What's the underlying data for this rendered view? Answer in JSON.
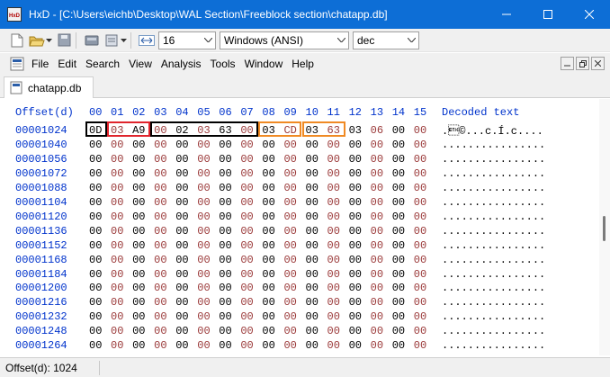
{
  "window": {
    "title": "HxD - [C:\\Users\\eichb\\Desktop\\WAL Section\\Freeblock section\\chatapp.db]",
    "app_icon_text": "HxD"
  },
  "toolbar": {
    "bytes_per_row": "16",
    "charset": "Windows (ANSI)",
    "offset_base": "dec"
  },
  "menu": [
    "File",
    "Edit",
    "Search",
    "View",
    "Analysis",
    "Tools",
    "Window",
    "Help"
  ],
  "tab": {
    "label": "chatapp.db"
  },
  "hex": {
    "offset_header": "Offset(d)",
    "columns": [
      "00",
      "01",
      "02",
      "03",
      "04",
      "05",
      "06",
      "07",
      "08",
      "09",
      "10",
      "11",
      "12",
      "13",
      "14",
      "15"
    ],
    "decoded_header": "Decoded text",
    "rows": [
      {
        "offset": "00001024",
        "bytes": [
          "0D",
          "03",
          "A9",
          "00",
          "02",
          "03",
          "63",
          "00",
          "03",
          "CD",
          "03",
          "63",
          "03",
          "06",
          "00",
          "00"
        ],
        "decoded": ".\u0003©...c.Í.c...."
      },
      {
        "offset": "00001040",
        "bytes": [
          "00",
          "00",
          "00",
          "00",
          "00",
          "00",
          "00",
          "00",
          "00",
          "00",
          "00",
          "00",
          "00",
          "00",
          "00",
          "00"
        ],
        "decoded": "................"
      },
      {
        "offset": "00001056",
        "bytes": [
          "00",
          "00",
          "00",
          "00",
          "00",
          "00",
          "00",
          "00",
          "00",
          "00",
          "00",
          "00",
          "00",
          "00",
          "00",
          "00"
        ],
        "decoded": "................"
      },
      {
        "offset": "00001072",
        "bytes": [
          "00",
          "00",
          "00",
          "00",
          "00",
          "00",
          "00",
          "00",
          "00",
          "00",
          "00",
          "00",
          "00",
          "00",
          "00",
          "00"
        ],
        "decoded": "................"
      },
      {
        "offset": "00001088",
        "bytes": [
          "00",
          "00",
          "00",
          "00",
          "00",
          "00",
          "00",
          "00",
          "00",
          "00",
          "00",
          "00",
          "00",
          "00",
          "00",
          "00"
        ],
        "decoded": "................"
      },
      {
        "offset": "00001104",
        "bytes": [
          "00",
          "00",
          "00",
          "00",
          "00",
          "00",
          "00",
          "00",
          "00",
          "00",
          "00",
          "00",
          "00",
          "00",
          "00",
          "00"
        ],
        "decoded": "................"
      },
      {
        "offset": "00001120",
        "bytes": [
          "00",
          "00",
          "00",
          "00",
          "00",
          "00",
          "00",
          "00",
          "00",
          "00",
          "00",
          "00",
          "00",
          "00",
          "00",
          "00"
        ],
        "decoded": "................"
      },
      {
        "offset": "00001136",
        "bytes": [
          "00",
          "00",
          "00",
          "00",
          "00",
          "00",
          "00",
          "00",
          "00",
          "00",
          "00",
          "00",
          "00",
          "00",
          "00",
          "00"
        ],
        "decoded": "................"
      },
      {
        "offset": "00001152",
        "bytes": [
          "00",
          "00",
          "00",
          "00",
          "00",
          "00",
          "00",
          "00",
          "00",
          "00",
          "00",
          "00",
          "00",
          "00",
          "00",
          "00"
        ],
        "decoded": "................"
      },
      {
        "offset": "00001168",
        "bytes": [
          "00",
          "00",
          "00",
          "00",
          "00",
          "00",
          "00",
          "00",
          "00",
          "00",
          "00",
          "00",
          "00",
          "00",
          "00",
          "00"
        ],
        "decoded": "................"
      },
      {
        "offset": "00001184",
        "bytes": [
          "00",
          "00",
          "00",
          "00",
          "00",
          "00",
          "00",
          "00",
          "00",
          "00",
          "00",
          "00",
          "00",
          "00",
          "00",
          "00"
        ],
        "decoded": "................"
      },
      {
        "offset": "00001200",
        "bytes": [
          "00",
          "00",
          "00",
          "00",
          "00",
          "00",
          "00",
          "00",
          "00",
          "00",
          "00",
          "00",
          "00",
          "00",
          "00",
          "00"
        ],
        "decoded": "................"
      },
      {
        "offset": "00001216",
        "bytes": [
          "00",
          "00",
          "00",
          "00",
          "00",
          "00",
          "00",
          "00",
          "00",
          "00",
          "00",
          "00",
          "00",
          "00",
          "00",
          "00"
        ],
        "decoded": "................"
      },
      {
        "offset": "00001232",
        "bytes": [
          "00",
          "00",
          "00",
          "00",
          "00",
          "00",
          "00",
          "00",
          "00",
          "00",
          "00",
          "00",
          "00",
          "00",
          "00",
          "00"
        ],
        "decoded": "................"
      },
      {
        "offset": "00001248",
        "bytes": [
          "00",
          "00",
          "00",
          "00",
          "00",
          "00",
          "00",
          "00",
          "00",
          "00",
          "00",
          "00",
          "00",
          "00",
          "00",
          "00"
        ],
        "decoded": "................"
      },
      {
        "offset": "00001264",
        "bytes": [
          "00",
          "00",
          "00",
          "00",
          "00",
          "00",
          "00",
          "00",
          "00",
          "00",
          "00",
          "00",
          "00",
          "00",
          "00",
          "00"
        ],
        "decoded": "................"
      }
    ],
    "highlights": [
      {
        "from": 0,
        "to": 0,
        "color": "#000000"
      },
      {
        "from": 1,
        "to": 2,
        "color": "#e0242c"
      },
      {
        "from": 3,
        "to": 7,
        "color": "#000000"
      },
      {
        "from": 8,
        "to": 9,
        "color": "#f08a24"
      },
      {
        "from": 10,
        "to": 11,
        "color": "#f08a24"
      }
    ]
  },
  "status": {
    "text": "Offset(d): 1024"
  }
}
